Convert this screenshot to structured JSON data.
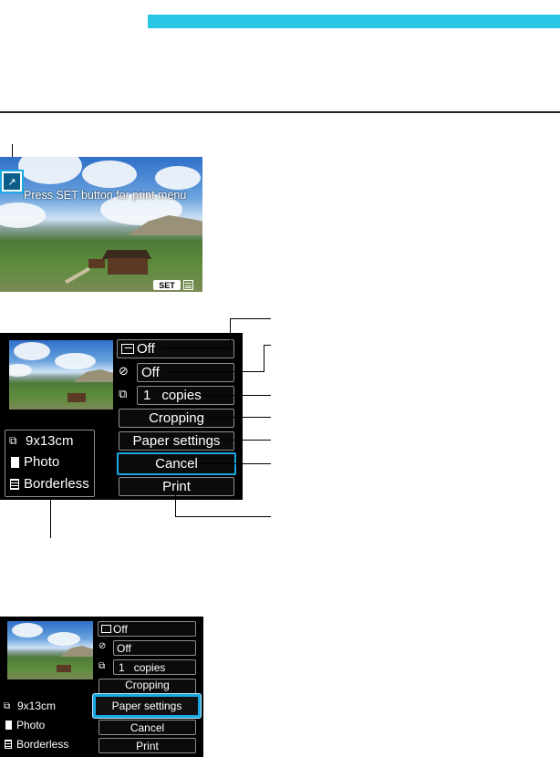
{
  "header": {
    "accent_color": "#2bc5e6"
  },
  "preview": {
    "message": "Press SET button for print menu",
    "set_key": "SET",
    "print_icon": "direct-print-icon",
    "menu_icon": "menu-icon"
  },
  "print_menu": {
    "effect_value": "Off",
    "date_value": "Off",
    "copies_count": "1",
    "copies_label": "copies",
    "cropping": "Cropping",
    "paper_settings": "Paper settings",
    "cancel": "Cancel",
    "print": "Print",
    "paper_size": "9x13cm",
    "paper_type": "Photo",
    "layout": "Borderless",
    "selection_color": "#18a9e4"
  },
  "print_menu_small": {
    "effect_value": "Off",
    "date_value": "Off",
    "copies_count": "1",
    "copies_label": "copies",
    "cropping": "Cropping",
    "paper_settings": "Paper settings",
    "cancel": "Cancel",
    "print": "Print",
    "paper_size": "9x13cm",
    "paper_type": "Photo",
    "layout": "Borderless"
  }
}
